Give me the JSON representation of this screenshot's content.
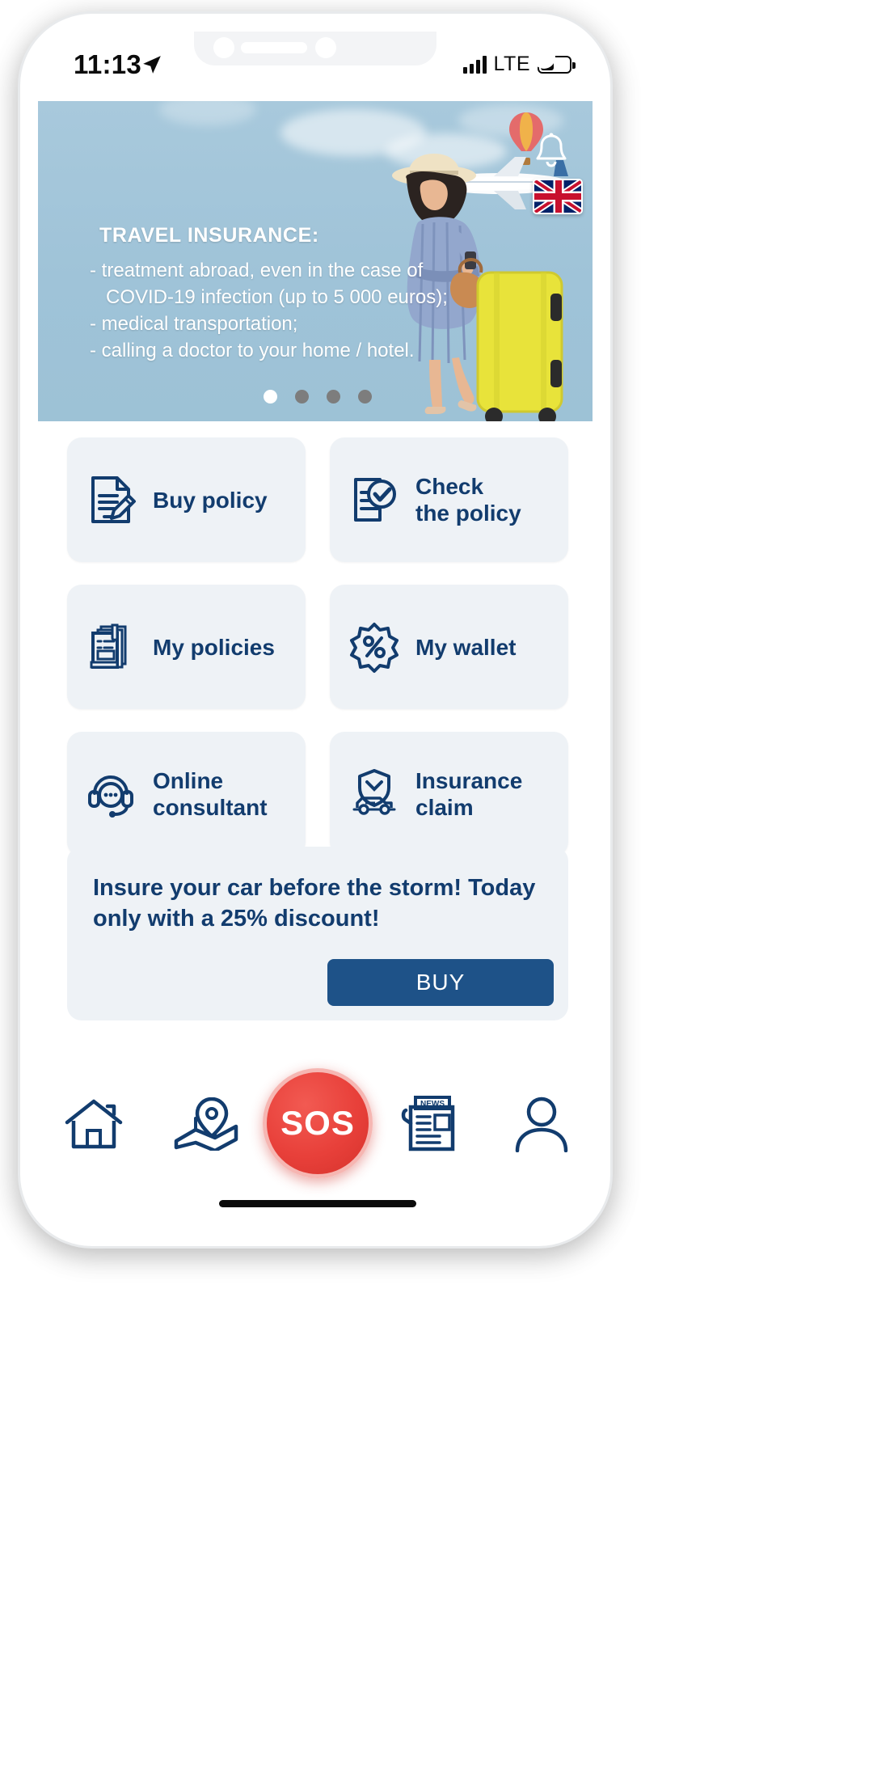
{
  "statusbar": {
    "time": "11:13",
    "location_icon": "location-arrow-icon",
    "network_label": "LTE",
    "signal_icon": "signal-bars-icon",
    "battery_icon": "battery-icon"
  },
  "hero": {
    "title": "TRAVEL INSURANCE:",
    "bullets": [
      "- treatment abroad, even in the case of",
      "   COVID-19 infection (up to 5 000 euros);",
      "- medical transportation;",
      "- calling a doctor to your home / hotel."
    ],
    "bell_icon": "notification-bell-icon",
    "flag_icon": "uk-flag-icon",
    "carousel": {
      "total": 4,
      "active_index": 0
    },
    "background_color": "#a3c6da"
  },
  "menu": {
    "cards": [
      {
        "label": "Buy policy",
        "icon": "document-pen-icon"
      },
      {
        "label": "Check\nthe policy",
        "label_line1": "Check",
        "label_line2": "the policy",
        "icon": "document-check-icon"
      },
      {
        "label": "My policies",
        "icon": "policy-stack-icon"
      },
      {
        "label": "My wallet",
        "icon": "percent-badge-icon"
      },
      {
        "label": "Online\nconsultant",
        "label_line1": "Online",
        "label_line2": "consultant",
        "icon": "headset-chat-icon"
      },
      {
        "label": "Insurance\nclaim",
        "label_line1": "Insurance",
        "label_line2": "claim",
        "icon": "car-shield-icon"
      }
    ],
    "card_bg": "#eef2f6",
    "text_color": "#123c6e"
  },
  "promo": {
    "text": "Insure your car before the storm! Today only with a 25% discount!",
    "line1": "Insure your car before the storm! Today",
    "line2": "only with a 25% discount!",
    "button_label": "BUY",
    "button_color": "#1e5288"
  },
  "bottom_nav": {
    "items": [
      {
        "name": "home",
        "icon": "home-icon",
        "label": ""
      },
      {
        "name": "map",
        "icon": "map-pin-icon",
        "label": ""
      },
      {
        "name": "sos",
        "icon": "sos-button",
        "label": "SOS"
      },
      {
        "name": "news",
        "icon": "newspaper-icon",
        "label": ""
      },
      {
        "name": "profile",
        "icon": "user-icon",
        "label": ""
      }
    ],
    "sos_label": "SOS",
    "sos_color": "#e8403a",
    "icon_color": "#123c6e"
  }
}
